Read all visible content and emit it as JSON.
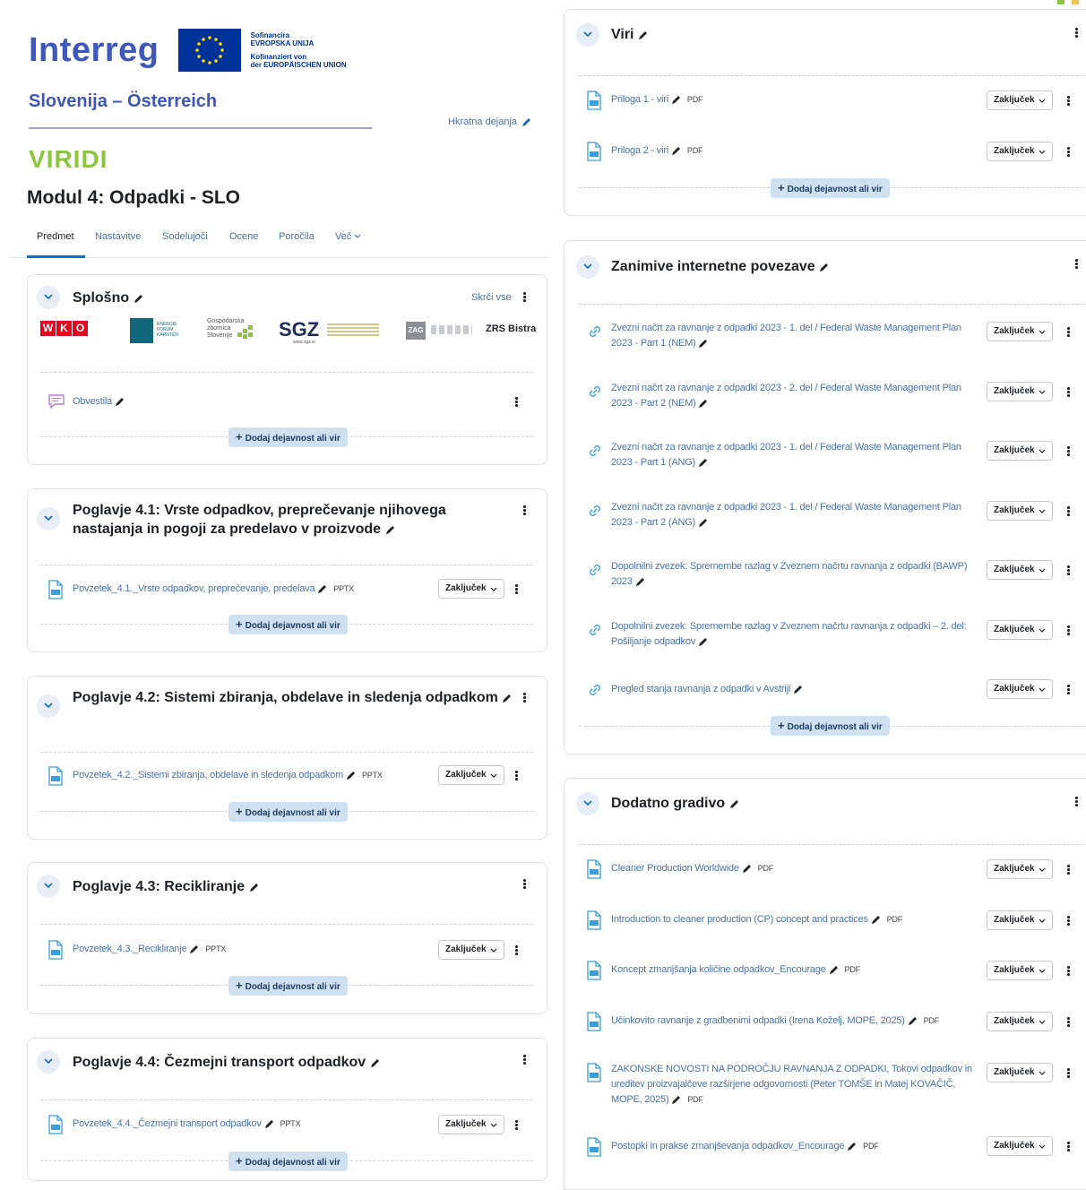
{
  "header": {
    "logo_text": "Interreg",
    "cofund_lines": [
      "Sofinancira",
      "EVROPSKA UNIJA",
      "Kofinanziert von",
      "der EUROPÄISCHEN UNION"
    ],
    "program": "Slovenija – Österreich",
    "quick_edit": "Hkratna dejanja",
    "project": "VIRIDI",
    "course_title": "Modul 4: Odpadki - SLO"
  },
  "tabs": [
    "Predmet",
    "Nastavitve",
    "Sodelujoči",
    "Ocene",
    "Poročila",
    "Več"
  ],
  "common": {
    "add_label": "Dodaj dejavnost ali vir",
    "add_plus": "+",
    "completion_label": "Zaključek",
    "hide_all": "Skrči vse"
  },
  "partners": {
    "wko_letters": [
      "W",
      "K",
      "O"
    ],
    "efk_text": "ENERGIE FORUM KÄRNTEN",
    "gzs_text": "Gospodarska zbornica Slovenije",
    "sgz_text": "SGZ",
    "sgz_url": "www.sgz.si",
    "zag_text": "ZAG",
    "zrs_text": "ZRS Bistra"
  },
  "sections_left": [
    {
      "title": "Splošno",
      "activities": [
        {
          "name": "Obvestila",
          "type": ""
        }
      ]
    },
    {
      "title": "Poglavje 4.1: Vrste odpadkov, preprečevanje njihovega nastajanja in pogoji za predelavo v proizvode",
      "activities": [
        {
          "name": "Povzetek_4.1._Vrste odpadkov, preprečevanje, predelava",
          "type": "PPTX"
        }
      ]
    },
    {
      "title": "Poglavje 4.2: Sistemi zbiranja, obdelave in sledenja odpadkom",
      "activities": [
        {
          "name": "Povzetek_4.2._Sistemi zbiranja, obdelave in sledenja odpadkom",
          "type": "PPTX"
        }
      ]
    },
    {
      "title": "Poglavje 4.3: Recikliranje",
      "activities": [
        {
          "name": "Povzetek_4.3._Recikliranje",
          "type": "PPTX"
        }
      ]
    },
    {
      "title": "Poglavje 4.4: Čezmejni transport odpadkov",
      "activities": [
        {
          "name": "Povzetek_4.4._Čezmejni transport odpadkov",
          "type": "PPTX"
        }
      ]
    }
  ],
  "sections_right": [
    {
      "title": "Viri",
      "activities": [
        {
          "name": "Priloga 1 - viri",
          "type": "PDF"
        },
        {
          "name": "Priloga 2 - viri",
          "type": "PDF"
        }
      ]
    },
    {
      "title": "Zanimive internetne povezave",
      "activities": [
        {
          "name": "Zvezni načrt za ravnanje z odpadki 2023 - 1. del / Federal Waste Management Plan 2023 - Part 1 (NEM)",
          "type": ""
        },
        {
          "name": "Zvezni načrt za ravnanje z odpadki 2023 - 2. del / Federal Waste Management Plan 2023 - Part 2 (NEM)",
          "type": ""
        },
        {
          "name": "Zvezni načrt za ravnanje z odpadki 2023 - 1. del / Federal Waste Management Plan 2023 - Part 1 (ANG)",
          "type": ""
        },
        {
          "name": "Zvezni načrt za ravnanje z odpadki 2023 - 1. del / Federal Waste Management Plan 2023 - Part 2 (ANG)",
          "type": ""
        },
        {
          "name": "Dopolnilni zvezek: Spremembe razlag v Zveznem načrtu ravnanja z odpadki (BAWP) 2023",
          "type": ""
        },
        {
          "name": "Dopolnilni zvezek: Spremembe razlag v Zveznem načrtu ravnanja z odpadki – 2. del: Pošiljanje odpadkov",
          "type": ""
        },
        {
          "name": "Pregled stanja ravnanja z odpadki v Avstriji",
          "type": ""
        }
      ]
    },
    {
      "title": "Dodatno gradivo",
      "activities": [
        {
          "name": "Cleaner Production Worldwide",
          "type": "PDF"
        },
        {
          "name": "Introduction to cleaner production (CP) concept and practices",
          "type": "PDF"
        },
        {
          "name": "Koncept zmanjšanja količine odpadkov_Encourage",
          "type": "PDF"
        },
        {
          "name": "Učinkovito ravnanje z gradbenimi odpadki (Irena Koželj, MOPE, 2025)",
          "type": "PDF"
        },
        {
          "name": "ZAKONSKE NOVOSTI NA PODROČJU RAVNANJA Z ODPADKI, Tokovi odpadkov in ureditev proizvajalčeve razširjene odgovornosti (Peter TOMŠE in Matej KOVAČIČ, MOPE, 2025)",
          "type": "PDF"
        },
        {
          "name": "Postopki in prakse zmanjševanja odpadkov_Encourage",
          "type": "PDF"
        }
      ]
    }
  ],
  "colors": {
    "interreg_blue": "#4057ba",
    "viridi_green": "#8cc63f",
    "link_blue": "#4a73a8",
    "add_button_bg": "#cfe0f1"
  }
}
